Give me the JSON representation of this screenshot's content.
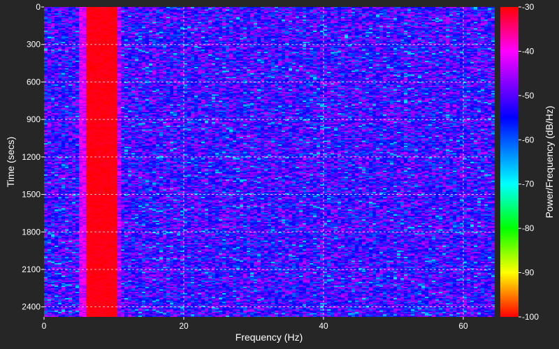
{
  "chart_data": {
    "type": "heatmap",
    "title": "",
    "xlabel": "Frequency (Hz)",
    "ylabel": "Time (secs)",
    "colorbar_label": "Power/Frequency (dB/Hz)",
    "xlim": [
      0,
      64.5
    ],
    "ylim": [
      0,
      2480
    ],
    "y_inverted": true,
    "clim": [
      -100,
      -30
    ],
    "x_ticks": [
      0,
      20,
      40,
      60
    ],
    "y_ticks": [
      0,
      300,
      600,
      900,
      1200,
      1500,
      1800,
      2100,
      2400
    ],
    "colorbar_ticks": [
      -30,
      -40,
      -50,
      -60,
      -70,
      -80,
      -90,
      -100
    ],
    "grid": true,
    "colormap": "hsv-reversed (red=-100, yellow=-90, green=-80, cyan=-70, blue=-55, magenta=-40, red=-30)",
    "background_level_db": -52,
    "background_range_db": [
      -62,
      -43
    ],
    "peak": {
      "freq_range_hz": [
        6,
        10.5
      ],
      "level_db": -30,
      "description": "strong narrow band around 7-10 Hz across all time"
    }
  }
}
